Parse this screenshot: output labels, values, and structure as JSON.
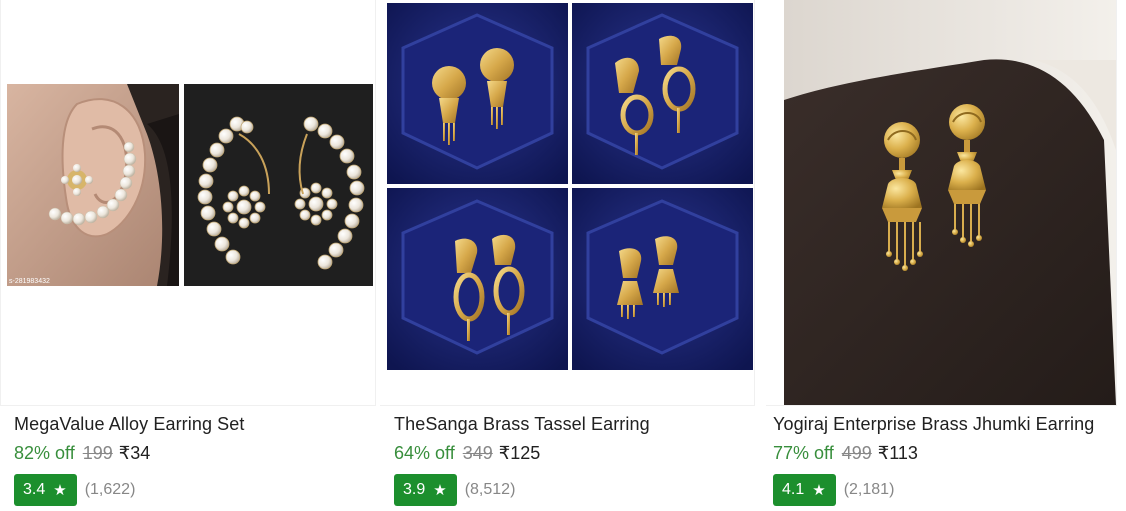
{
  "products": [
    {
      "title": "MegaValue Alloy Earring Set",
      "discount": "82% off",
      "mrp": "199",
      "price": "₹34",
      "rating": "3.4",
      "rating_count": "(1,622)",
      "image_watermark": "s-281983432"
    },
    {
      "title": "TheSanga Brass Tassel Earring",
      "discount": "64% off",
      "mrp": "349",
      "price": "₹125",
      "rating": "3.9",
      "rating_count": "(8,512)"
    },
    {
      "title": "Yogiraj Enterprise Brass Jhumki Earring",
      "discount": "77% off",
      "mrp": "499",
      "price": "₹113",
      "rating": "4.1",
      "rating_count": "(2,181)"
    }
  ],
  "icons": {
    "rating_star": "star-icon"
  },
  "colors": {
    "discount": "#388e3c",
    "rating_badge": "#1c8f2d",
    "mrp": "#878787",
    "title": "#212121"
  }
}
